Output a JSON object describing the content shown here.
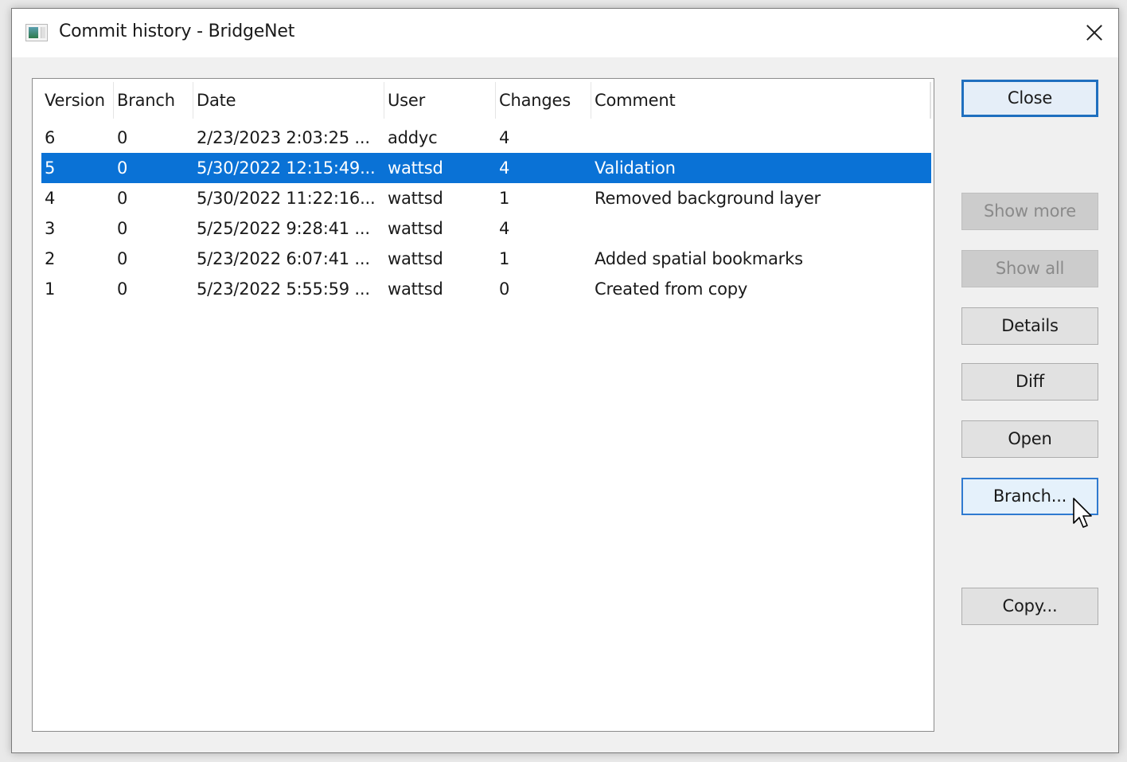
{
  "window": {
    "title": "Commit history - BridgeNet",
    "app_icon": "window-app-icon",
    "close_icon": "close-x-icon"
  },
  "list": {
    "columns": [
      "Version",
      "Branch",
      "Date",
      "User",
      "Changes",
      "Comment"
    ],
    "rows": [
      {
        "version": "6",
        "branch": "0",
        "date": "2/23/2023 2:03:25 ...",
        "user": "addyc",
        "changes": "4",
        "comment": "",
        "selected": false
      },
      {
        "version": "5",
        "branch": "0",
        "date": "5/30/2022 12:15:49...",
        "user": "wattsd",
        "changes": "4",
        "comment": "Validation",
        "selected": true
      },
      {
        "version": "4",
        "branch": "0",
        "date": "5/30/2022 11:22:16...",
        "user": "wattsd",
        "changes": "1",
        "comment": "Removed background layer",
        "selected": false
      },
      {
        "version": "3",
        "branch": "0",
        "date": "5/25/2022 9:28:41 ...",
        "user": "wattsd",
        "changes": "4",
        "comment": "",
        "selected": false
      },
      {
        "version": "2",
        "branch": "0",
        "date": "5/23/2022 6:07:41 ...",
        "user": "wattsd",
        "changes": "1",
        "comment": "Added spatial bookmarks",
        "selected": false
      },
      {
        "version": "1",
        "branch": "0",
        "date": "5/23/2022 5:55:59 ...",
        "user": "wattsd",
        "changes": "0",
        "comment": "Created from copy",
        "selected": false
      }
    ],
    "selection_color": "#0a72d6"
  },
  "buttons": {
    "close": {
      "label": "Close",
      "state": "default"
    },
    "show_more": {
      "label": "Show more",
      "state": "disabled"
    },
    "show_all": {
      "label": "Show all",
      "state": "disabled"
    },
    "details": {
      "label": "Details",
      "state": "normal"
    },
    "diff": {
      "label": "Diff",
      "state": "normal"
    },
    "open": {
      "label": "Open",
      "state": "normal"
    },
    "branch": {
      "label": "Branch...",
      "state": "hover"
    },
    "copy": {
      "label": "Copy...",
      "state": "normal"
    }
  },
  "pointer": "arrow-cursor-icon"
}
